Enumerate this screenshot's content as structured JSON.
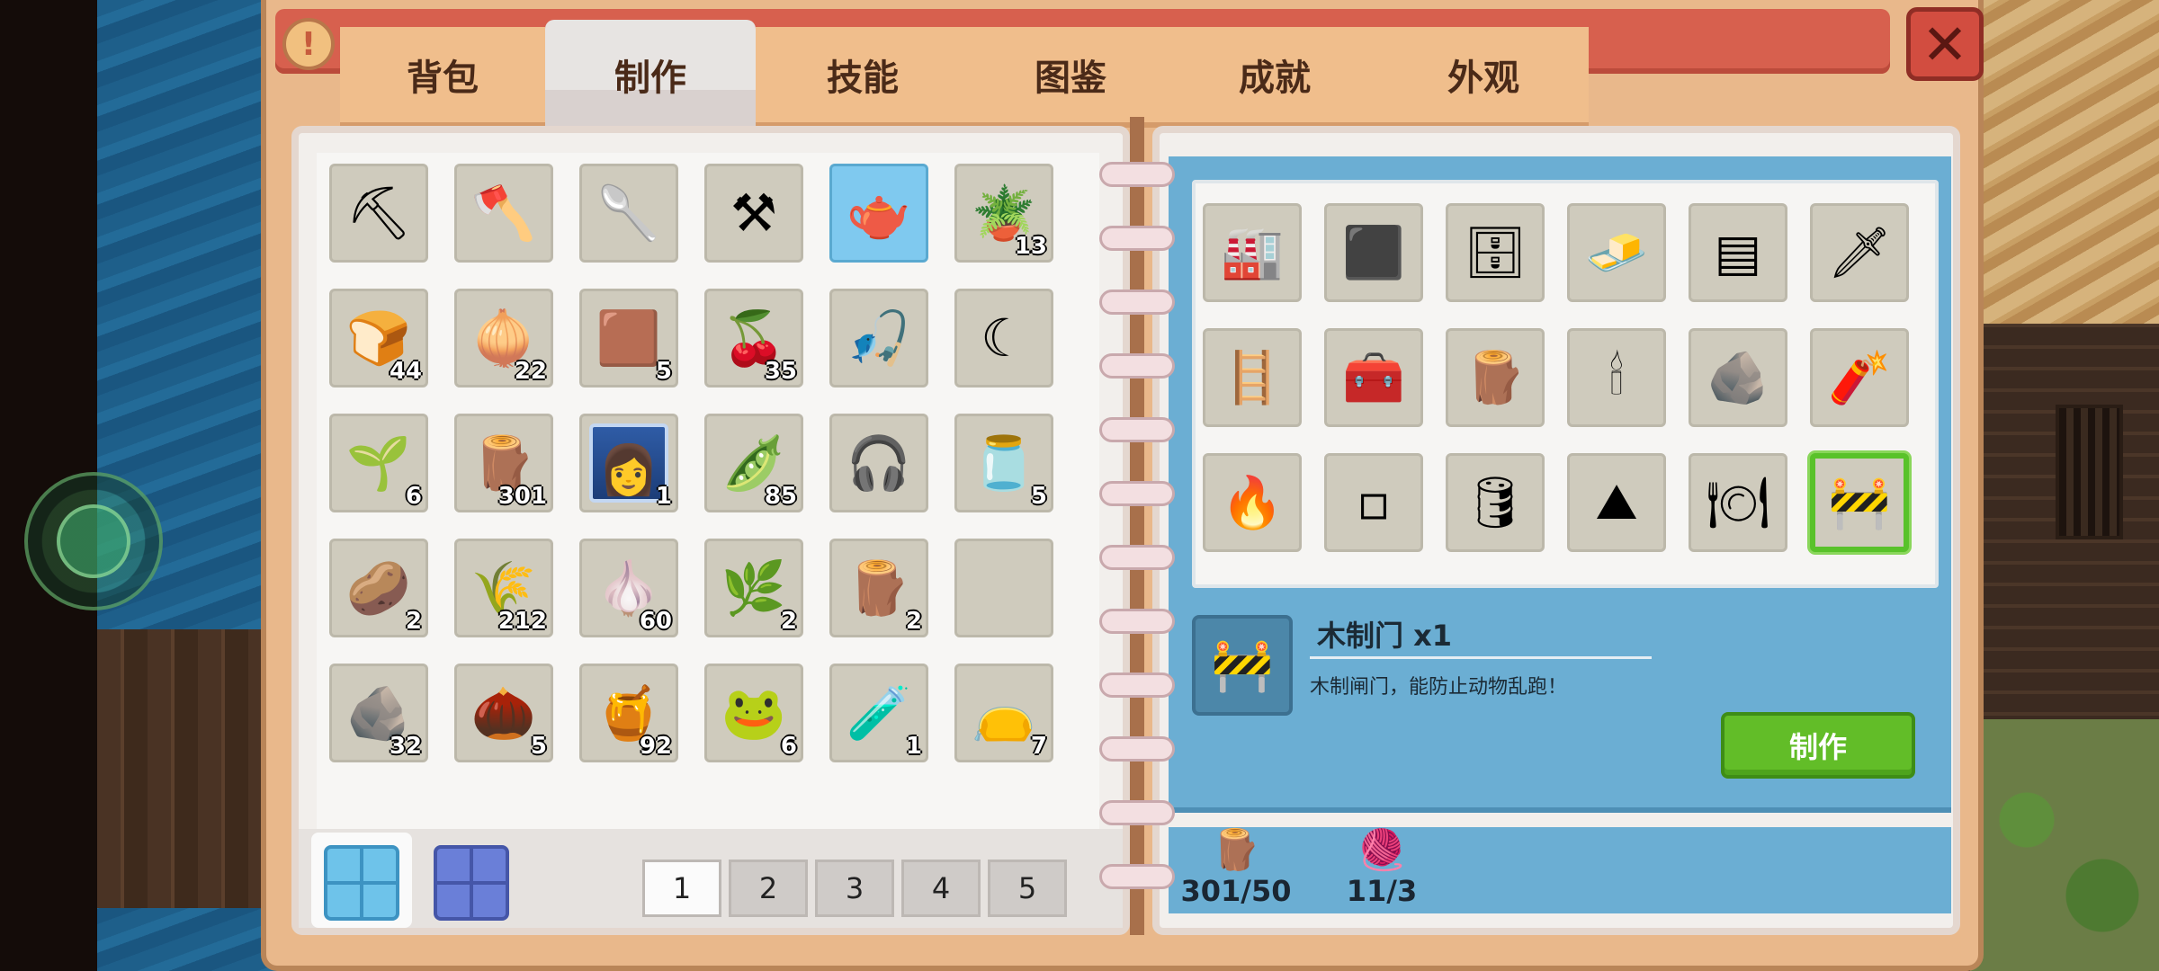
{
  "tabs": [
    "背包",
    "制作",
    "技能",
    "图鉴",
    "成就",
    "外观"
  ],
  "active_tab": "制作",
  "inventory": [
    {
      "icon": "pickaxe-icon",
      "glyph": "⛏",
      "count": ""
    },
    {
      "icon": "axe-icon",
      "glyph": "🪓",
      "count": ""
    },
    {
      "icon": "shovel-icon",
      "glyph": "🥄",
      "count": ""
    },
    {
      "icon": "hoe-icon",
      "glyph": "⚒",
      "count": ""
    },
    {
      "icon": "watering-can-icon",
      "glyph": "🫖",
      "count": "",
      "highlight": true
    },
    {
      "icon": "seed-pot-icon",
      "glyph": "🪴",
      "count": "13"
    },
    {
      "icon": "bread-icon",
      "glyph": "🍞",
      "count": "44"
    },
    {
      "icon": "onion-icon",
      "glyph": "🧅",
      "count": "22"
    },
    {
      "icon": "dirt-icon",
      "glyph": "🟫",
      "count": "5"
    },
    {
      "icon": "cherry-icon",
      "glyph": "🍒",
      "count": "35"
    },
    {
      "icon": "fishing-rod-icon",
      "glyph": "🎣",
      "count": ""
    },
    {
      "icon": "sickle-icon",
      "glyph": "☾",
      "count": ""
    },
    {
      "icon": "sprout-icon",
      "glyph": "🌱",
      "count": "6"
    },
    {
      "icon": "branch-icon",
      "glyph": "🪵",
      "count": "301"
    },
    {
      "icon": "portrait-icon",
      "glyph": "👩",
      "count": "1",
      "portrait": true
    },
    {
      "icon": "bean-icon",
      "glyph": "🫛",
      "count": "85"
    },
    {
      "icon": "headphones-icon",
      "glyph": "🎧",
      "count": ""
    },
    {
      "icon": "milk-jar-icon",
      "glyph": "🫙",
      "count": "5"
    },
    {
      "icon": "potato-icon",
      "glyph": "🥔",
      "count": "2"
    },
    {
      "icon": "wheat-icon",
      "glyph": "🌾",
      "count": "212"
    },
    {
      "icon": "garlic-icon",
      "glyph": "🧄",
      "count": "60"
    },
    {
      "icon": "herb-icon",
      "glyph": "🌿",
      "count": "2"
    },
    {
      "icon": "log-icon",
      "glyph": "🪵",
      "count": "2"
    },
    {
      "icon": "empty-slot",
      "glyph": "",
      "count": ""
    },
    {
      "icon": "coal-icon",
      "glyph": "🪨",
      "count": "32"
    },
    {
      "icon": "seeds-icon",
      "glyph": "🌰",
      "count": "5"
    },
    {
      "icon": "honey-jar-icon",
      "glyph": "🍯",
      "count": "92"
    },
    {
      "icon": "slime-pet-icon",
      "glyph": "🐸",
      "count": "6"
    },
    {
      "icon": "potion-vial-icon",
      "glyph": "🧪",
      "count": "1"
    },
    {
      "icon": "seed-bag-icon",
      "glyph": "👝",
      "count": "7"
    }
  ],
  "pages": [
    "1",
    "2",
    "3",
    "4",
    "5"
  ],
  "active_page": "1",
  "recipes": [
    {
      "icon": "furnace-icon",
      "glyph": "🏭"
    },
    {
      "icon": "anvil-icon",
      "glyph": "⬛"
    },
    {
      "icon": "chest-dark-icon",
      "glyph": "🗄"
    },
    {
      "icon": "ore-cluster-icon",
      "glyph": "🧈"
    },
    {
      "icon": "metal-grate-icon",
      "glyph": "▤"
    },
    {
      "icon": "wooden-sword-icon",
      "glyph": "🗡"
    },
    {
      "icon": "wooden-fence-icon",
      "glyph": "🪜"
    },
    {
      "icon": "wooden-chest-icon",
      "glyph": "🧰"
    },
    {
      "icon": "planks-icon",
      "glyph": "🪵"
    },
    {
      "icon": "torch-icon",
      "glyph": "🕯"
    },
    {
      "icon": "stone-pile-icon",
      "glyph": "🪨"
    },
    {
      "icon": "grenade-icon",
      "glyph": "🧨"
    },
    {
      "icon": "campfire-icon",
      "glyph": "🔥"
    },
    {
      "icon": "stepping-stones-icon",
      "glyph": "▫"
    },
    {
      "icon": "iron-barrel-icon",
      "glyph": "🛢"
    },
    {
      "icon": "rock-icon",
      "glyph": "⛰"
    },
    {
      "icon": "plate-icon",
      "glyph": "🍽"
    },
    {
      "icon": "wooden-gate-icon",
      "glyph": "🚧",
      "selected": true
    }
  ],
  "detail": {
    "icon": "wooden-gate-icon",
    "glyph": "🚧",
    "name": "木制门 x1",
    "description": "木制闸门，能防止动物乱跑！",
    "craft_label": "制作"
  },
  "materials": [
    {
      "icon": "branch-icon",
      "glyph": "🪵",
      "amount": "301/50"
    },
    {
      "icon": "fiber-icon",
      "glyph": "🧶",
      "amount": "11/3"
    }
  ],
  "info_glyph": "!",
  "close_glyph": "✕"
}
